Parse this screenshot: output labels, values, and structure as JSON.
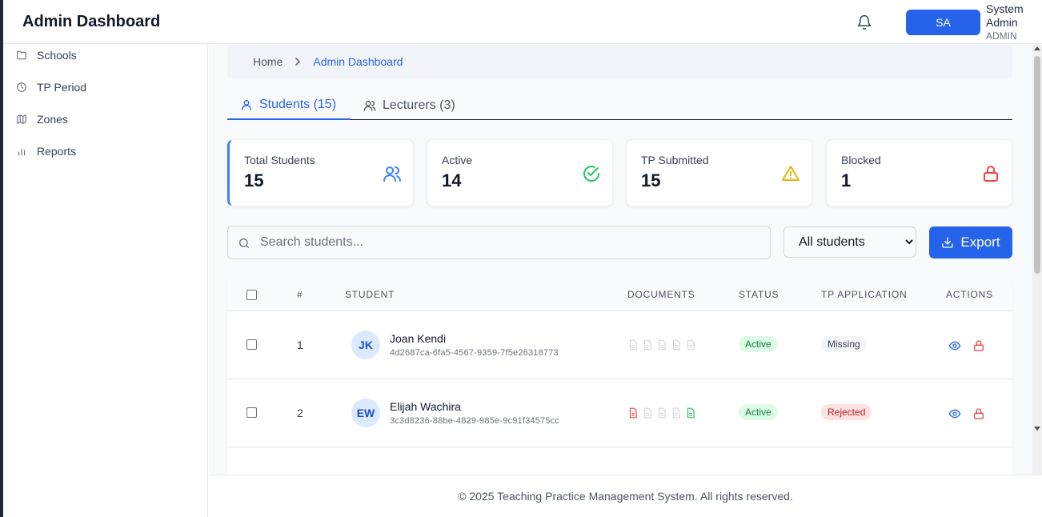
{
  "header": {
    "title": "Admin Dashboard",
    "avatar_initials": "SA",
    "user_name": "System Admin",
    "user_role": "ADMIN"
  },
  "sidebar": {
    "items": [
      {
        "label": "Schools",
        "icon": "folder-icon"
      },
      {
        "label": "TP Period",
        "icon": "clock-icon"
      },
      {
        "label": "Zones",
        "icon": "map-icon"
      },
      {
        "label": "Reports",
        "icon": "bar-chart-icon"
      }
    ]
  },
  "breadcrumb": {
    "home": "Home",
    "current": "Admin Dashboard"
  },
  "tabs": [
    {
      "label": "Students (15)",
      "active": true
    },
    {
      "label": "Lecturers (3)",
      "active": false
    }
  ],
  "stats": [
    {
      "label": "Total Students",
      "value": "15",
      "icon": "users-icon",
      "color": "#3b82f6"
    },
    {
      "label": "Active",
      "value": "14",
      "icon": "check-circle-icon",
      "color": "#22c55e"
    },
    {
      "label": "TP Submitted",
      "value": "15",
      "icon": "warning-icon",
      "color": "#eab308"
    },
    {
      "label": "Blocked",
      "value": "1",
      "icon": "lock-icon",
      "color": "#ef4444"
    }
  ],
  "search": {
    "placeholder": "Search students..."
  },
  "filter": {
    "selected": "All students"
  },
  "export_label": "Export",
  "table": {
    "headers": [
      "#",
      "STUDENT",
      "DOCUMENTS",
      "STATUS",
      "TP APPLICATION",
      "ACTIONS"
    ],
    "rows": [
      {
        "num": "1",
        "initials": "JK",
        "name": "Joan Kendi",
        "id": "4d2687ca-6fa5-4567-9359-7f5e26318773",
        "docs": [
          "gray",
          "gray",
          "gray",
          "gray",
          "gray"
        ],
        "status": "Active",
        "tp": "Missing"
      },
      {
        "num": "2",
        "initials": "EW",
        "name": "Elijah Wachira",
        "id": "3c3d8236-88be-4829-985e-9c91f34575cc",
        "docs": [
          "red",
          "gray",
          "gray",
          "gray",
          "green"
        ],
        "status": "Active",
        "tp": "Rejected"
      }
    ]
  },
  "footer": "© 2025 Teaching Practice Management System. All rights reserved."
}
